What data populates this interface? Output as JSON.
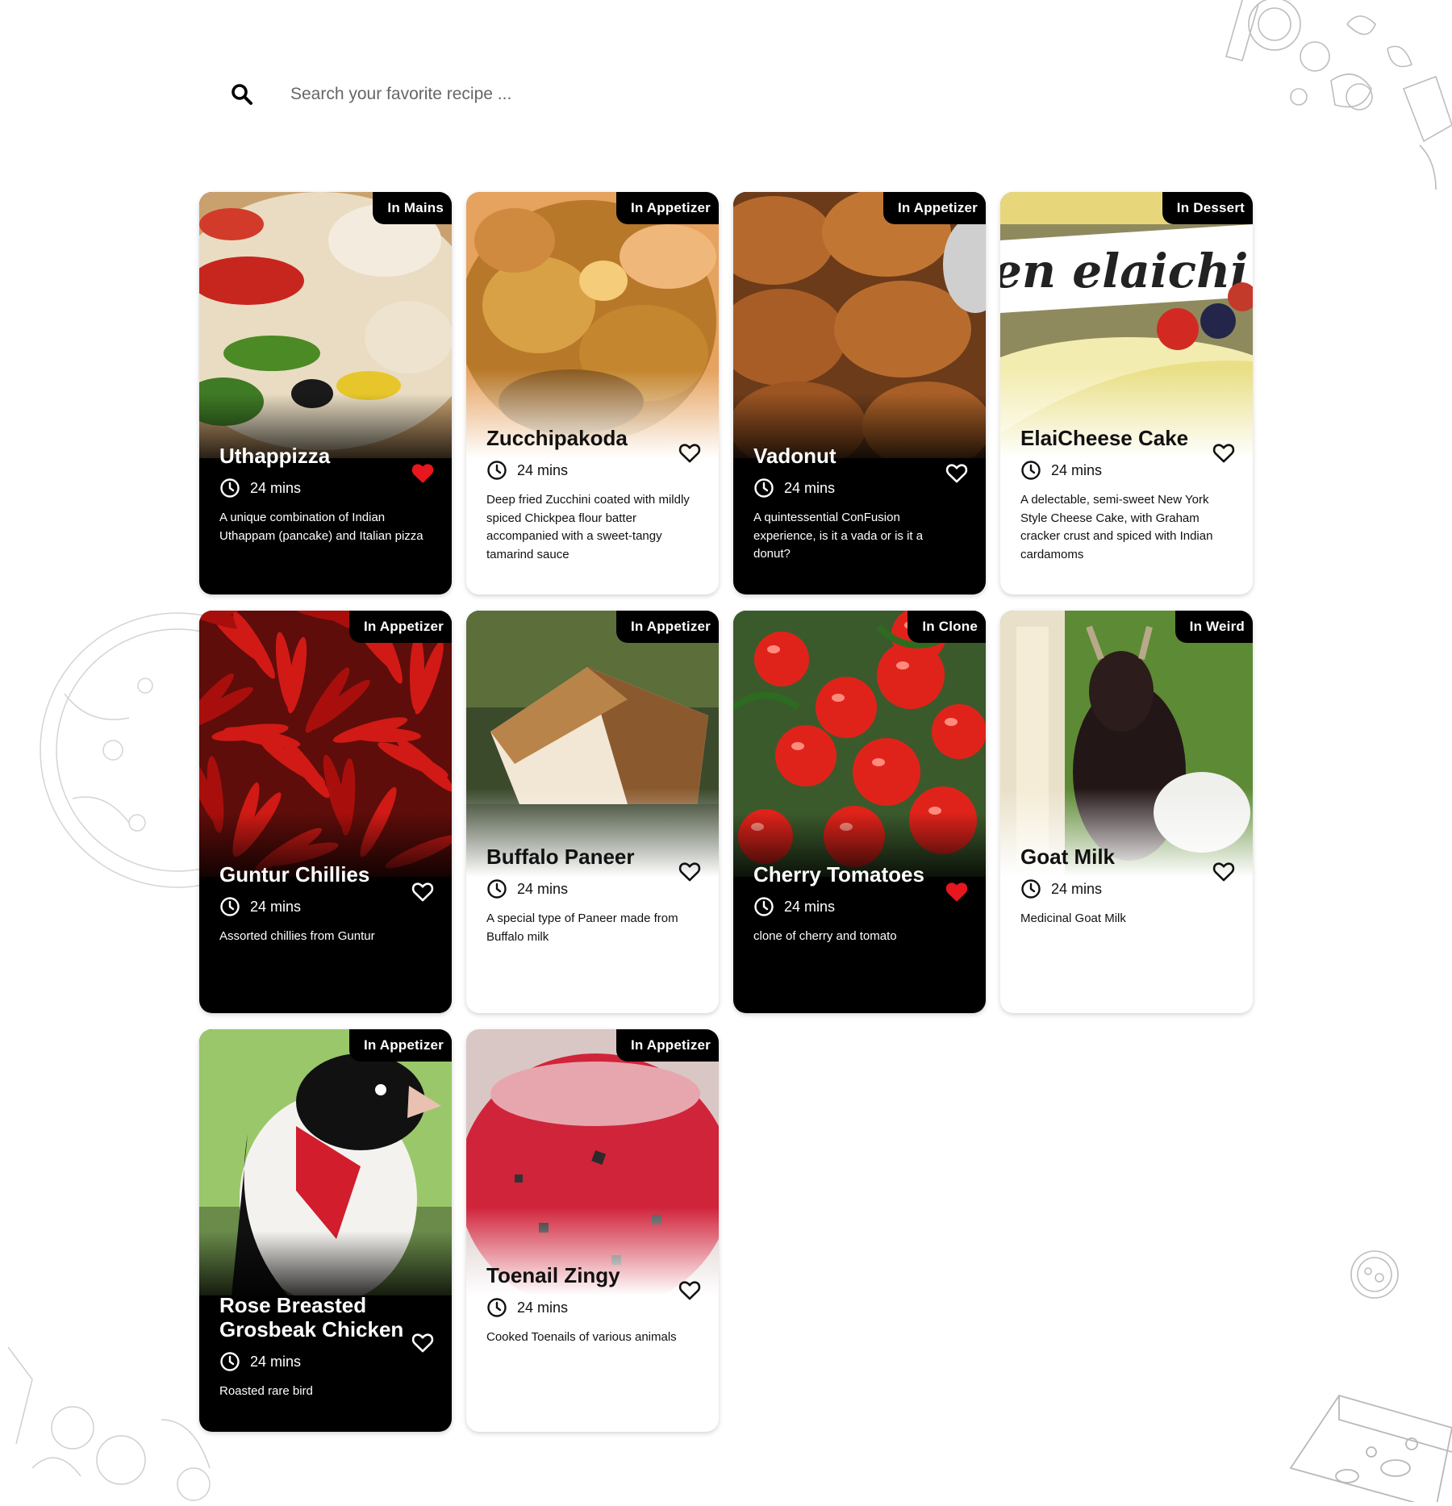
{
  "search": {
    "placeholder": "Search your favorite recipe ..."
  },
  "colors": {
    "accent_red": "#e8161d",
    "dark_card": "#000000",
    "light_card": "#ffffff"
  },
  "recipes": [
    {
      "name": "Uthappizza",
      "category": "In Mains",
      "time": "24 mins",
      "description": "A unique combination of Indian Uthappam (pancake) and Italian pizza",
      "theme": "dark",
      "favorite": true,
      "image": "pizza"
    },
    {
      "name": "Zucchipakoda",
      "category": "In Appetizer",
      "time": "24 mins",
      "description": "Deep fried Zucchini coated with mildly spiced Chickpea flour batter accompanied with a sweet-tangy tamarind sauce",
      "theme": "light",
      "favorite": false,
      "image": "pakoda"
    },
    {
      "name": "Vadonut",
      "category": "In Appetizer",
      "time": "24 mins",
      "description": "A quintessential ConFusion experience, is it a vada or is it a donut?",
      "theme": "dark",
      "favorite": false,
      "image": "donuts"
    },
    {
      "name": "ElaiCheese Cake",
      "category": "In Dessert",
      "time": "24 mins",
      "description": "A delectable, semi-sweet New York Style Cheese Cake, with Graham cracker crust and spiced with Indian cardamoms",
      "theme": "light",
      "favorite": false,
      "image": "cheesecake",
      "image_text": "en elaichi c"
    },
    {
      "name": "Guntur Chillies",
      "category": "In Appetizer",
      "time": "24 mins",
      "description": "Assorted chillies from Guntur",
      "theme": "dark",
      "favorite": false,
      "image": "chillies"
    },
    {
      "name": "Buffalo Paneer",
      "category": "In Appetizer",
      "time": "24 mins",
      "description": "A special type of Paneer made from Buffalo milk",
      "theme": "light",
      "favorite": false,
      "image": "paneer"
    },
    {
      "name": "Cherry Tomatoes",
      "category": "In Clone",
      "time": "24 mins",
      "description": "clone of cherry and tomato",
      "theme": "dark",
      "favorite": true,
      "image": "tomatoes"
    },
    {
      "name": "Goat Milk",
      "category": "In Weird",
      "time": "24 mins",
      "description": "Medicinal Goat Milk",
      "theme": "light",
      "favorite": false,
      "image": "goat"
    },
    {
      "name": "Rose Breasted Grosbeak Chicken",
      "category": "In Appetizer",
      "time": "24 mins",
      "description": "Roasted rare bird",
      "theme": "dark",
      "favorite": false,
      "image": "bird"
    },
    {
      "name": "Toenail Zingy",
      "category": "In Appetizer",
      "time": "24 mins",
      "description": "Cooked Toenails of various animals",
      "theme": "light",
      "favorite": false,
      "image": "zingy"
    }
  ]
}
